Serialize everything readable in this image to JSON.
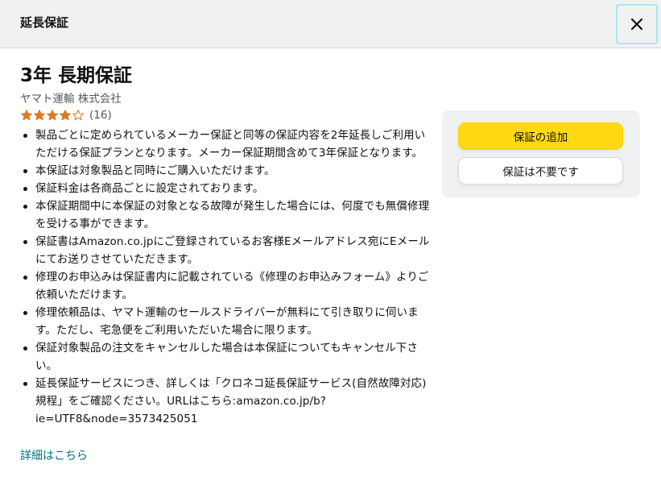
{
  "header": {
    "title": "延長保証",
    "close_icon": "close-icon"
  },
  "product": {
    "title": "3年 長期保証",
    "seller": "ヤマト運輸 株式会社",
    "rating": 4.0,
    "rating_max": 5,
    "review_count": "(16)",
    "star_color": "#de7921"
  },
  "bullets": [
    "製品ごとに定められているメーカー保証と同等の保証内容を2年延長しご利用いただける保証プランとなります。メーカー保証期間含めて3年保証となります。",
    "本保証は対象製品と同時にご購入いただけます。",
    "保証料金は各商品ごとに設定されております。",
    "本保証期間中に本保証の対象となる故障が発生した場合には、何度でも無償修理を受ける事ができます。",
    "保証書はAmazon.co.jpにご登録されているお客様Eメールアドレス宛にEメールにてお送りさせていただきます。",
    "修理のお申込みは保証書内に記載されている《修理のお申込みフォーム》よりご依頼いただけます。",
    "修理依頼品は、ヤマト運輸のセールスドライバーが無料にて引き取りに伺います。ただし、宅急便をご利用いただいた場合に限ります。",
    "保証対象製品の注文をキャンセルした場合は本保証についてもキャンセル下さい。",
    "延長保証サービスにつき、詳しくは「クロネコ延長保証サービス(自然故障対応)規程」をご確認ください。URLはこちら:amazon.co.jp/b?ie=UTF8&node=3573425051"
  ],
  "details_link": "詳細はこちら",
  "actions": {
    "add_label": "保証の追加",
    "decline_label": "保証は不要です",
    "add_color": "#ffd814"
  }
}
